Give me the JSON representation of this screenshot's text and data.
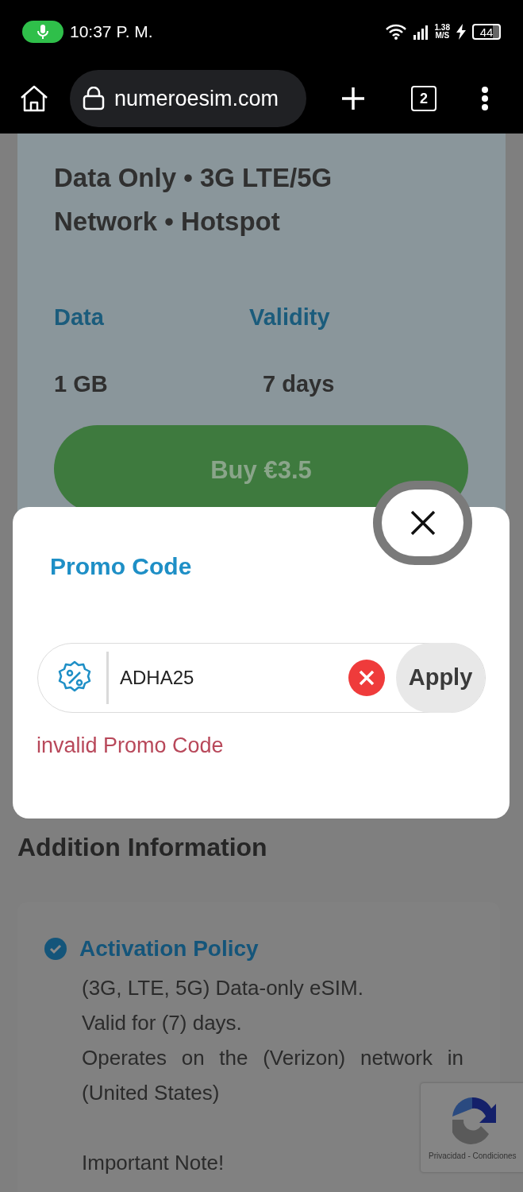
{
  "status_bar": {
    "time": "10:37 P. M.",
    "speed": "1.38",
    "speed_unit": "M/S",
    "battery": "44"
  },
  "browser": {
    "url": "numeroesim.com",
    "tab_count": "2"
  },
  "plan": {
    "description": "Data Only • 3G LTE/5G Network • Hotspot",
    "specs": [
      {
        "label": "Data",
        "value": "1 GB"
      },
      {
        "label": "Validity",
        "value": "7 days"
      }
    ],
    "buy_button": "Buy €3.5"
  },
  "promo_dialog": {
    "title": "Promo Code",
    "value": "ADHA25",
    "apply_button": "Apply",
    "error": "invalid Promo Code"
  },
  "additional_info": {
    "heading": "Addition Information",
    "policies": [
      {
        "title": "Activation Policy",
        "paragraphs": [
          [
            "(3G, LTE, 5G) Data-only eSIM.",
            "Valid for (7) days.",
            "Operates on the (Verizon) network in (United States)"
          ],
          [
            "Important Note!"
          ]
        ]
      }
    ]
  },
  "recaptcha": {
    "links": "Privacidad - Condiciones"
  }
}
